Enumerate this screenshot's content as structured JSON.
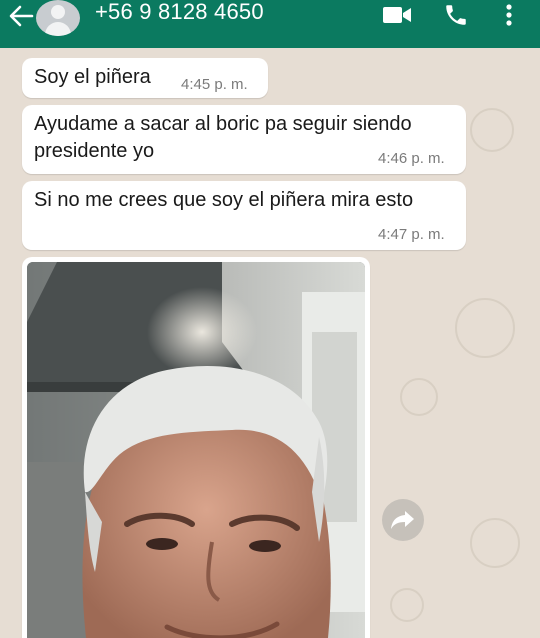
{
  "header": {
    "contact_name": "+56 9 8128 4650",
    "icons": [
      "back-arrow-icon",
      "avatar",
      "video-call-icon",
      "phone-call-icon",
      "more-options-icon"
    ]
  },
  "messages": [
    {
      "text": "Soy el piñera",
      "time": "4:45 p. m."
    },
    {
      "text": "Ayudame a sacar al boric pa seguir siendo presidente yo",
      "time": "4:46 p. m."
    },
    {
      "text": "Si no me crees que soy el piñera mira esto",
      "time": "4:47 p. m."
    }
  ],
  "image_message": {
    "kind": "photo",
    "subject": "photo-of-gray-haired-man-in-kitchen"
  },
  "colors": {
    "header": "#0b7a60",
    "chat_bg": "#e6ddd3",
    "bubble": "#ffffff",
    "time_text": "#7b7b7b"
  }
}
